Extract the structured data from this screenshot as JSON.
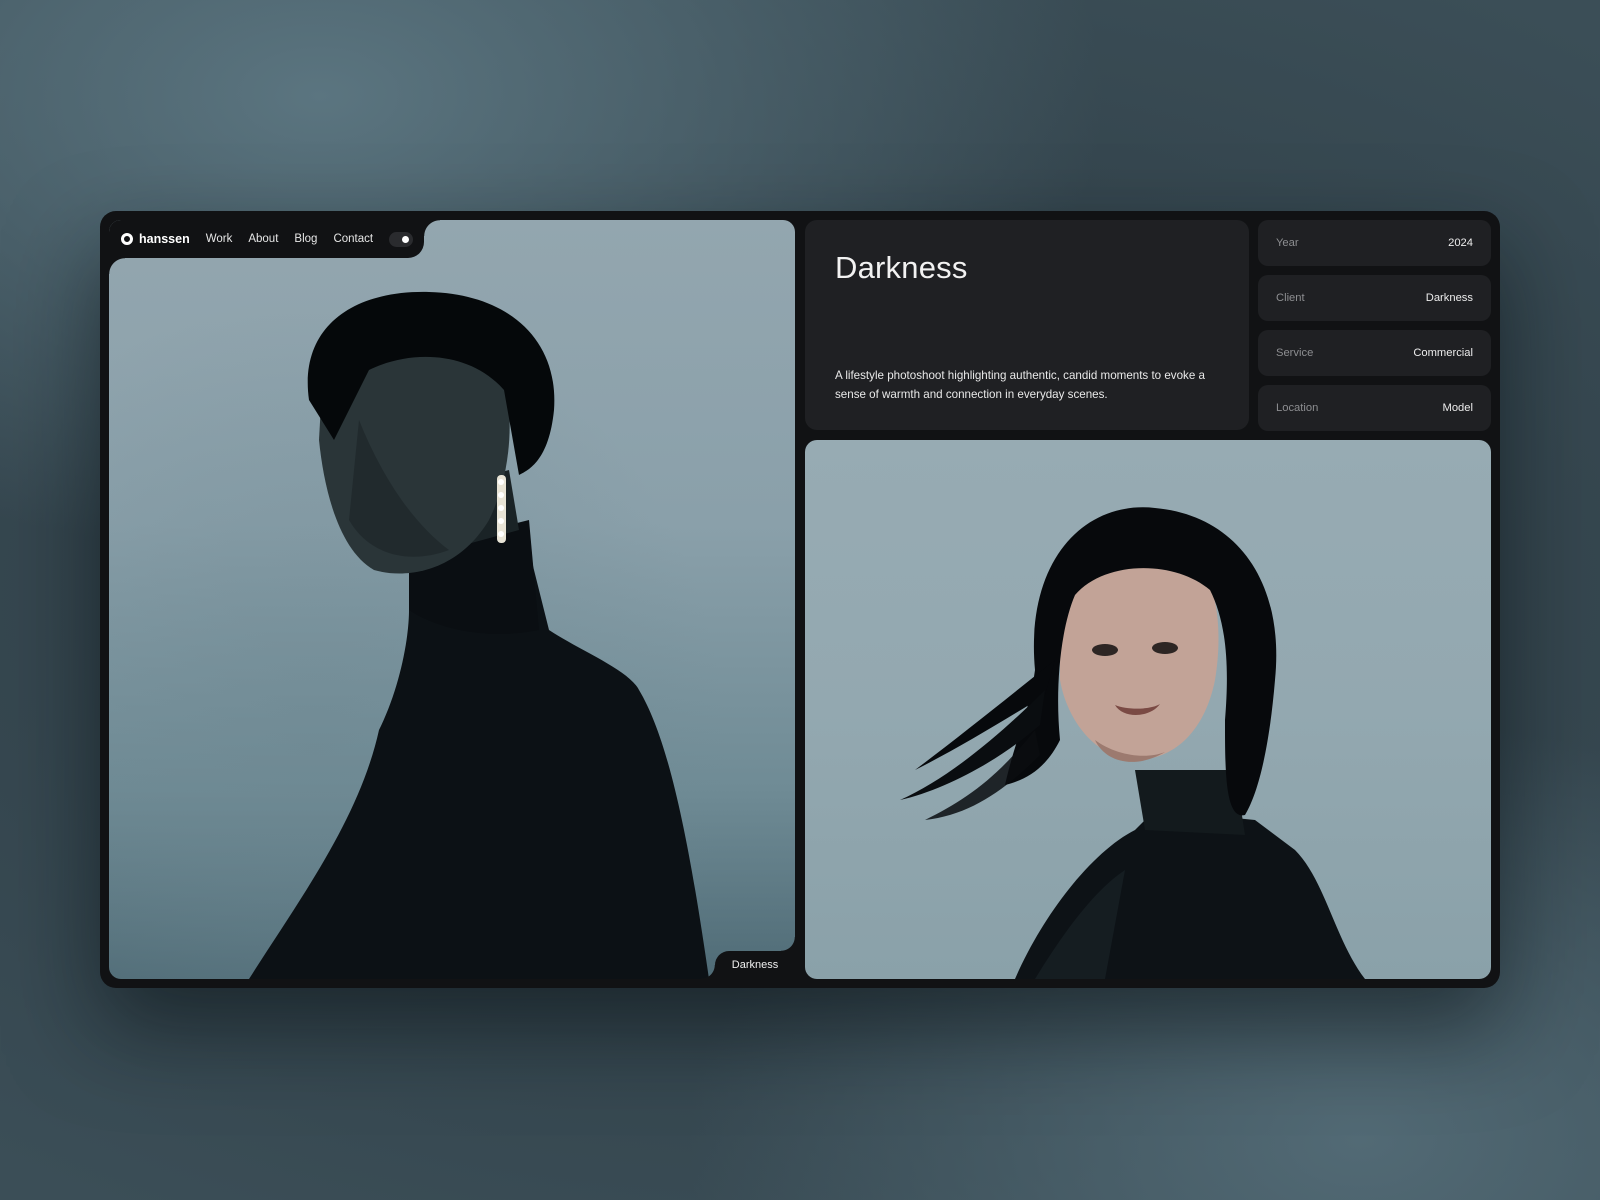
{
  "nav": {
    "logo_text": "hanssen",
    "links": [
      "Work",
      "About",
      "Blog",
      "Contact"
    ]
  },
  "project": {
    "title": "Darkness",
    "description": "A lifestyle photoshoot highlighting authentic, candid moments to evoke a sense of warmth and connection in everyday scenes.",
    "caption": "Darkness"
  },
  "meta": [
    {
      "label": "Year",
      "value": "2024"
    },
    {
      "label": "Client",
      "value": "Darkness"
    },
    {
      "label": "Service",
      "value": "Commercial"
    },
    {
      "label": "Location",
      "value": "Model"
    }
  ],
  "colors": {
    "frame": "#111214",
    "card": "#1f2023",
    "text": "#f2f2f2",
    "muted": "#8d8e91"
  },
  "icons": {
    "logo": "ring-logo-icon",
    "theme_toggle": "theme-toggle-icon"
  }
}
